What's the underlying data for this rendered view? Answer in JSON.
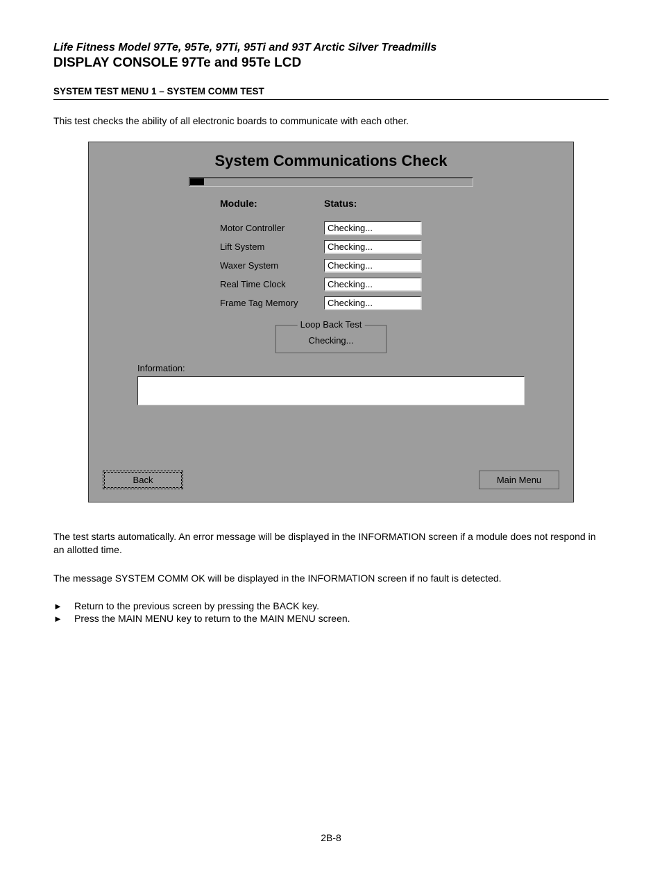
{
  "header": {
    "line1": "Life Fitness Model 97Te, 95Te, 97Ti, 95Ti and 93T Arctic Silver Treadmills",
    "line2": "DISPLAY CONSOLE 97Te and 95Te LCD"
  },
  "section_heading": "SYSTEM TEST MENU 1 – SYSTEM COMM TEST",
  "intro": "This test checks the ability of all electronic boards to communicate with each other.",
  "lcd": {
    "title": "System Communications Check",
    "col_module": "Module:",
    "col_status": "Status:",
    "rows": [
      {
        "module": "Motor Controller",
        "status": "Checking..."
      },
      {
        "module": "Lift System",
        "status": "Checking..."
      },
      {
        "module": "Waxer System",
        "status": "Checking..."
      },
      {
        "module": "Real Time Clock",
        "status": "Checking..."
      },
      {
        "module": "Frame Tag Memory",
        "status": "Checking..."
      }
    ],
    "loop_legend": "Loop Back Test",
    "loop_value": "Checking...",
    "info_label": "Information:",
    "back_btn": "Back",
    "main_btn": "Main Menu"
  },
  "para1": "The test starts automatically. An error message will be displayed in the INFORMATION screen if a module does not respond in an allotted time.",
  "para2": "The message SYSTEM COMM OK will be displayed in the INFORMATION screen if no fault is detected.",
  "bullets": [
    "Return to the previous screen by pressing the BACK key.",
    "Press the MAIN MENU key to return to the MAIN MENU screen."
  ],
  "page_num": "2B-8"
}
